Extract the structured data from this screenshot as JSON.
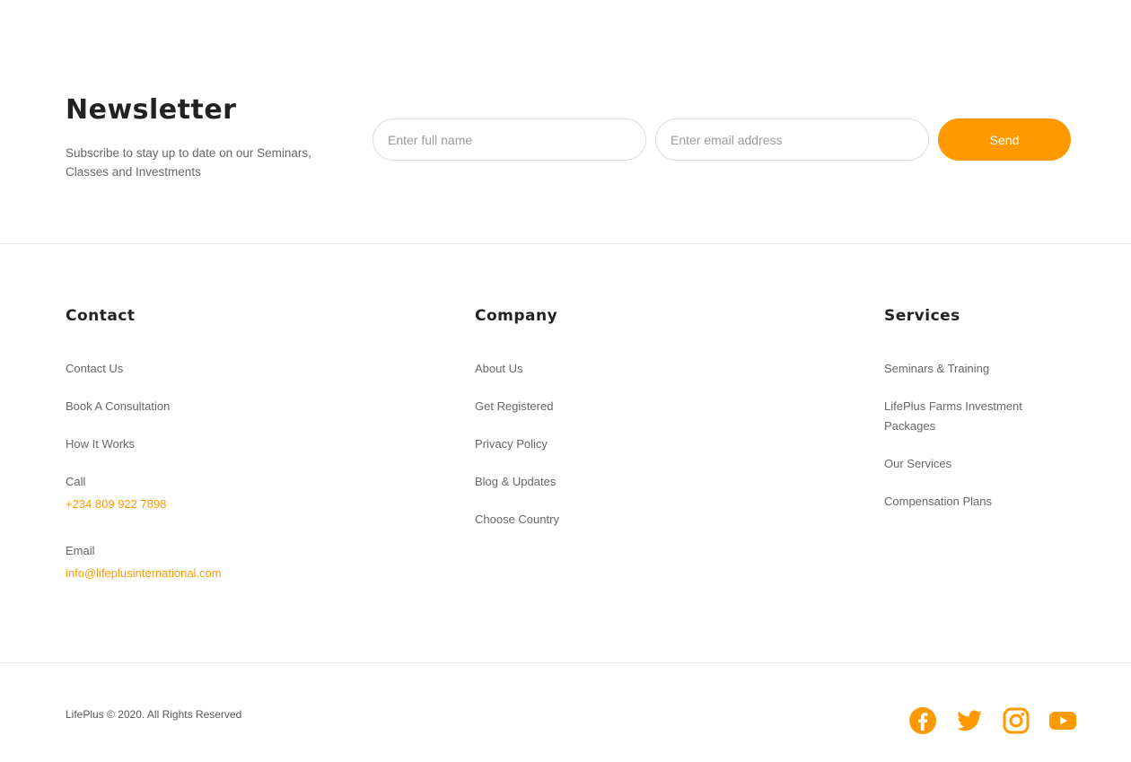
{
  "newsletter": {
    "title": "Newsletter",
    "subtitle": "Subscribe to stay up to date on our Seminars, Classes and Investments",
    "name_placeholder": "Enter full name",
    "email_placeholder": "Enter email address",
    "send_label": "Send"
  },
  "contact": {
    "title": "Contact",
    "links": [
      "Contact Us",
      "Book A Consultation",
      "How It Works"
    ],
    "call_label": "Call",
    "call_value": "+234 809 922 7898",
    "email_label": "Email",
    "email_value": "info@lifeplusinternational.com"
  },
  "company": {
    "title": "Company",
    "links": [
      "About Us",
      "Get Registered",
      "Privacy Policy",
      "Blog & Updates",
      "Choose Country"
    ]
  },
  "services": {
    "title": "Services",
    "links": [
      "Seminars & Training",
      "LifePlus Farms Investment Packages",
      "Our Services",
      "Compensation Plans"
    ]
  },
  "footer": {
    "copyright": "LifePlus © 2020. All Rights Reserved",
    "socials": [
      "facebook-icon",
      "twitter-icon",
      "instagram-icon",
      "youtube-icon"
    ]
  },
  "colors": {
    "accent": "#ff9900",
    "text": "#666666",
    "heading": "#222222"
  }
}
